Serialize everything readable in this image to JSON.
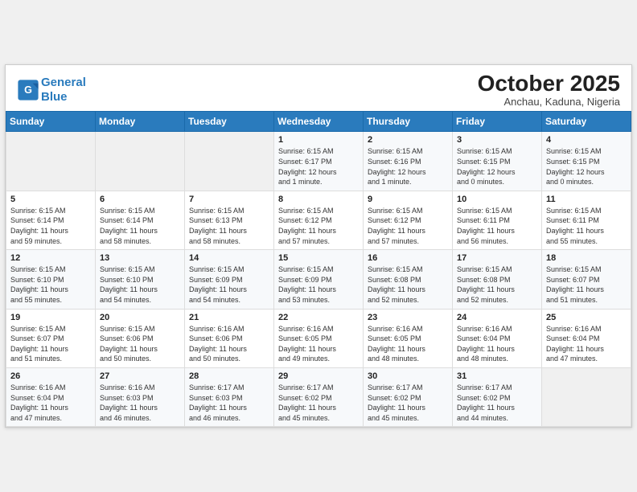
{
  "header": {
    "logo_line1": "General",
    "logo_line2": "Blue",
    "month": "October 2025",
    "location": "Anchau, Kaduna, Nigeria"
  },
  "weekdays": [
    "Sunday",
    "Monday",
    "Tuesday",
    "Wednesday",
    "Thursday",
    "Friday",
    "Saturday"
  ],
  "weeks": [
    [
      {
        "day": "",
        "info": ""
      },
      {
        "day": "",
        "info": ""
      },
      {
        "day": "",
        "info": ""
      },
      {
        "day": "1",
        "info": "Sunrise: 6:15 AM\nSunset: 6:17 PM\nDaylight: 12 hours\nand 1 minute."
      },
      {
        "day": "2",
        "info": "Sunrise: 6:15 AM\nSunset: 6:16 PM\nDaylight: 12 hours\nand 1 minute."
      },
      {
        "day": "3",
        "info": "Sunrise: 6:15 AM\nSunset: 6:15 PM\nDaylight: 12 hours\nand 0 minutes."
      },
      {
        "day": "4",
        "info": "Sunrise: 6:15 AM\nSunset: 6:15 PM\nDaylight: 12 hours\nand 0 minutes."
      }
    ],
    [
      {
        "day": "5",
        "info": "Sunrise: 6:15 AM\nSunset: 6:14 PM\nDaylight: 11 hours\nand 59 minutes."
      },
      {
        "day": "6",
        "info": "Sunrise: 6:15 AM\nSunset: 6:14 PM\nDaylight: 11 hours\nand 58 minutes."
      },
      {
        "day": "7",
        "info": "Sunrise: 6:15 AM\nSunset: 6:13 PM\nDaylight: 11 hours\nand 58 minutes."
      },
      {
        "day": "8",
        "info": "Sunrise: 6:15 AM\nSunset: 6:12 PM\nDaylight: 11 hours\nand 57 minutes."
      },
      {
        "day": "9",
        "info": "Sunrise: 6:15 AM\nSunset: 6:12 PM\nDaylight: 11 hours\nand 57 minutes."
      },
      {
        "day": "10",
        "info": "Sunrise: 6:15 AM\nSunset: 6:11 PM\nDaylight: 11 hours\nand 56 minutes."
      },
      {
        "day": "11",
        "info": "Sunrise: 6:15 AM\nSunset: 6:11 PM\nDaylight: 11 hours\nand 55 minutes."
      }
    ],
    [
      {
        "day": "12",
        "info": "Sunrise: 6:15 AM\nSunset: 6:10 PM\nDaylight: 11 hours\nand 55 minutes."
      },
      {
        "day": "13",
        "info": "Sunrise: 6:15 AM\nSunset: 6:10 PM\nDaylight: 11 hours\nand 54 minutes."
      },
      {
        "day": "14",
        "info": "Sunrise: 6:15 AM\nSunset: 6:09 PM\nDaylight: 11 hours\nand 54 minutes."
      },
      {
        "day": "15",
        "info": "Sunrise: 6:15 AM\nSunset: 6:09 PM\nDaylight: 11 hours\nand 53 minutes."
      },
      {
        "day": "16",
        "info": "Sunrise: 6:15 AM\nSunset: 6:08 PM\nDaylight: 11 hours\nand 52 minutes."
      },
      {
        "day": "17",
        "info": "Sunrise: 6:15 AM\nSunset: 6:08 PM\nDaylight: 11 hours\nand 52 minutes."
      },
      {
        "day": "18",
        "info": "Sunrise: 6:15 AM\nSunset: 6:07 PM\nDaylight: 11 hours\nand 51 minutes."
      }
    ],
    [
      {
        "day": "19",
        "info": "Sunrise: 6:15 AM\nSunset: 6:07 PM\nDaylight: 11 hours\nand 51 minutes."
      },
      {
        "day": "20",
        "info": "Sunrise: 6:15 AM\nSunset: 6:06 PM\nDaylight: 11 hours\nand 50 minutes."
      },
      {
        "day": "21",
        "info": "Sunrise: 6:16 AM\nSunset: 6:06 PM\nDaylight: 11 hours\nand 50 minutes."
      },
      {
        "day": "22",
        "info": "Sunrise: 6:16 AM\nSunset: 6:05 PM\nDaylight: 11 hours\nand 49 minutes."
      },
      {
        "day": "23",
        "info": "Sunrise: 6:16 AM\nSunset: 6:05 PM\nDaylight: 11 hours\nand 48 minutes."
      },
      {
        "day": "24",
        "info": "Sunrise: 6:16 AM\nSunset: 6:04 PM\nDaylight: 11 hours\nand 48 minutes."
      },
      {
        "day": "25",
        "info": "Sunrise: 6:16 AM\nSunset: 6:04 PM\nDaylight: 11 hours\nand 47 minutes."
      }
    ],
    [
      {
        "day": "26",
        "info": "Sunrise: 6:16 AM\nSunset: 6:04 PM\nDaylight: 11 hours\nand 47 minutes."
      },
      {
        "day": "27",
        "info": "Sunrise: 6:16 AM\nSunset: 6:03 PM\nDaylight: 11 hours\nand 46 minutes."
      },
      {
        "day": "28",
        "info": "Sunrise: 6:17 AM\nSunset: 6:03 PM\nDaylight: 11 hours\nand 46 minutes."
      },
      {
        "day": "29",
        "info": "Sunrise: 6:17 AM\nSunset: 6:02 PM\nDaylight: 11 hours\nand 45 minutes."
      },
      {
        "day": "30",
        "info": "Sunrise: 6:17 AM\nSunset: 6:02 PM\nDaylight: 11 hours\nand 45 minutes."
      },
      {
        "day": "31",
        "info": "Sunrise: 6:17 AM\nSunset: 6:02 PM\nDaylight: 11 hours\nand 44 minutes."
      },
      {
        "day": "",
        "info": ""
      }
    ]
  ]
}
